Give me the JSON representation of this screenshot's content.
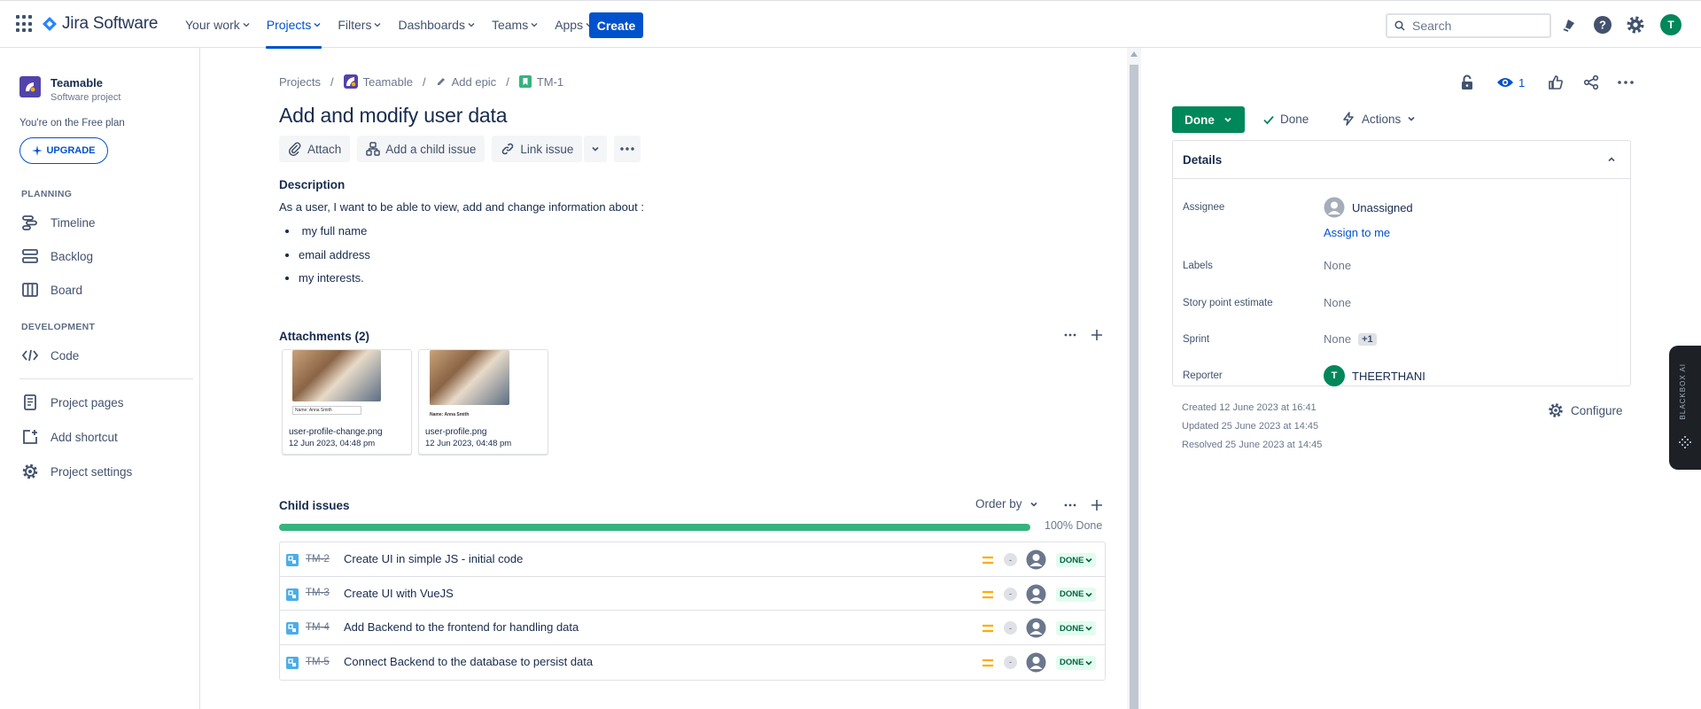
{
  "topnav": {
    "product": "Jira Software",
    "items": [
      {
        "label": "Your work"
      },
      {
        "label": "Projects"
      },
      {
        "label": "Filters"
      },
      {
        "label": "Dashboards"
      },
      {
        "label": "Teams"
      },
      {
        "label": "Apps"
      }
    ],
    "create_label": "Create",
    "search_placeholder": "Search",
    "user_initial": "T",
    "icons": [
      "app-switcher-icon",
      "notifications-icon",
      "help-icon",
      "settings-icon"
    ]
  },
  "sidebar": {
    "project_name": "Teamable",
    "project_type": "Software project",
    "plan_text": "You're on the Free plan",
    "upgrade_label": "UPGRADE",
    "sections": {
      "planning": "PLANNING",
      "development": "DEVELOPMENT"
    },
    "items": [
      {
        "label": "Timeline",
        "icon": "timeline-icon"
      },
      {
        "label": "Backlog",
        "icon": "backlog-icon"
      },
      {
        "label": "Board",
        "icon": "board-icon"
      },
      {
        "label": "Code",
        "icon": "code-icon"
      },
      {
        "label": "Project pages",
        "icon": "pages-icon"
      },
      {
        "label": "Add shortcut",
        "icon": "add-shortcut-icon"
      },
      {
        "label": "Project settings",
        "icon": "settings-icon"
      }
    ]
  },
  "issue": {
    "breadcrumb": [
      "Projects",
      "Teamable",
      "Add epic",
      "TM-1"
    ],
    "title": "Add and modify user data",
    "actions": {
      "attach": "Attach",
      "add_child": "Add a child issue",
      "link": "Link issue"
    },
    "description_heading": "Description",
    "description_intro": "As a user, I want to be able to view, add and change information about  :",
    "description_list": [
      " my full name",
      "email address",
      "my interests."
    ],
    "attachments_heading": "Attachments (2)",
    "attachments": [
      {
        "name": "user-profile-change.png",
        "date": "12 Jun 2023, 04:48 pm",
        "form_text": "Name: Anna Smith"
      },
      {
        "name": "user-profile.png",
        "date": "12 Jun 2023, 04:48 pm",
        "form_text": "Name: Anna Smith"
      }
    ],
    "child_heading": "Child issues",
    "order_by": "Order by",
    "progress_percent": 100,
    "progress_label": "100% Done",
    "children": [
      {
        "key": "TM-2",
        "summary": "Create UI in simple JS - initial code",
        "estimate": "-",
        "status": "DONE"
      },
      {
        "key": "TM-3",
        "summary": "Create UI with VueJS",
        "estimate": "-",
        "status": "DONE"
      },
      {
        "key": "TM-4",
        "summary": "Add Backend to the frontend for handling data",
        "estimate": "-",
        "status": "DONE"
      },
      {
        "key": "TM-5",
        "summary": "Connect Backend to the database to persist data",
        "estimate": "-",
        "status": "DONE"
      }
    ]
  },
  "panel": {
    "watchers": "1",
    "status_button": "Done",
    "resolution": "Done",
    "actions_label": "Actions",
    "details_heading": "Details",
    "fields": {
      "assignee_label": "Assignee",
      "assignee_value": "Unassigned",
      "assign_to_me": "Assign to me",
      "labels_label": "Labels",
      "labels_value": "None",
      "story_points_label": "Story point estimate",
      "story_points_value": "None",
      "sprint_label": "Sprint",
      "sprint_value": "None",
      "sprint_extra": "+1",
      "reporter_label": "Reporter",
      "reporter_value": "THEERTHANI",
      "reporter_initial": "T"
    },
    "created": "Created 12 June 2023 at 16:41",
    "updated": "Updated 25 June 2023 at 14:45",
    "resolved": "Resolved 25 June 2023 at 14:45",
    "configure_label": "Configure"
  },
  "blackbox_label": "BLACKBOX AI",
  "colors": {
    "brand": "#0052CC",
    "done_green": "#00875A",
    "progress": "#36B37E",
    "project_avatar": "#5243AA"
  }
}
